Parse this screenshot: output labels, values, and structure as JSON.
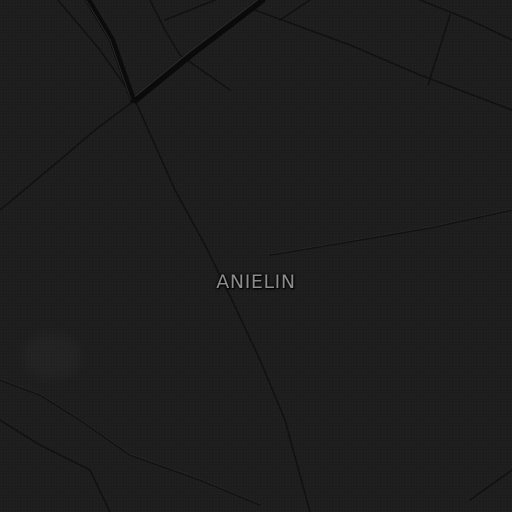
{
  "map": {
    "theme": "dark",
    "background_color": "#1d1d1d",
    "road_color": "#0e0e0e",
    "road_highlight_color": "#2c2c2c",
    "label_color": "#8c8c8c",
    "place_label": "ANIELIN"
  }
}
